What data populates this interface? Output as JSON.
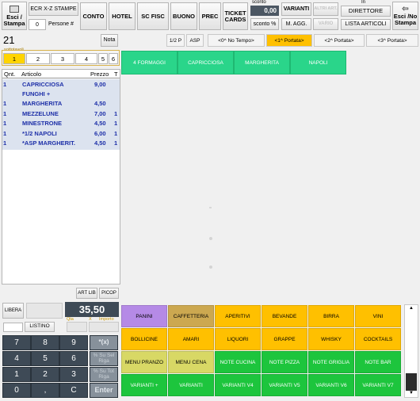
{
  "toolbar": {
    "esci_stampa": "Esci / Stampa",
    "ecr_xz": "ECR X-Z STAMPE",
    "persone_count": "0",
    "persone_label": "Persone #",
    "conto": "CONTO",
    "hotel": "HOTEL",
    "sc_fisc": "SC FISC",
    "buono": "BUONO",
    "prec": "PREC",
    "ticket_cards": "TICKET CARDS",
    "sconto_label": "sconto",
    "sconto_value": "0,00",
    "sconto_pct": "sconto %",
    "varianti": "VARIANTI",
    "m_agg": "M. AGG.",
    "disabled_top": "ALTRI ART.",
    "disabled_bottom": "VARIO",
    "in_label": "In",
    "direttore": "DIRETTORE",
    "lista_articoli": "LISTA ARTICOLI",
    "esci_no_stampa": "Esci /No Stampa"
  },
  "order": {
    "table_number": "21",
    "nota": "Nota",
    "sottotavoli_label": "sottotavoli",
    "subtables": [
      "1",
      "2",
      "3",
      "4",
      "5",
      "6"
    ],
    "columns": {
      "qnt": "Qnt.",
      "articolo": "Articolo",
      "prezzo": "Prezzo",
      "t": "T"
    },
    "rows": [
      {
        "qnt": "1",
        "articolo": "CAPRICCIOSA",
        "prezzo": "9,00",
        "t": ""
      },
      {
        "qnt": "",
        "articolo": "FUNGHI +",
        "prezzo": "",
        "t": ""
      },
      {
        "qnt": "1",
        "articolo": "MARGHERITA",
        "prezzo": "4,50",
        "t": ""
      },
      {
        "qnt": "1",
        "articolo": "MEZZELUNE",
        "prezzo": "7,00",
        "t": "1"
      },
      {
        "qnt": "1",
        "articolo": "MINESTRONE",
        "prezzo": "4,50",
        "t": "1"
      },
      {
        "qnt": "1",
        "articolo": "*1/2 NAPOLI",
        "prezzo": "6,00",
        "t": "1"
      },
      {
        "qnt": "1",
        "articolo": "*ASP MARGHERIT.",
        "prezzo": "4,50",
        "t": "1"
      }
    ],
    "art_lib": "ART LIB",
    "picop": "PICOP"
  },
  "bottom_left": {
    "libera": "LIBERA",
    "libera_disabled": "",
    "total": "35,50",
    "qta_label": "Qta",
    "x_label": "X",
    "importo_label": "Importo",
    "listino": "LISTINO"
  },
  "keypad": {
    "k7": "7",
    "k8": "8",
    "k9": "9",
    "star": "*(x)",
    "k4": "4",
    "k5": "5",
    "k6": "6",
    "g1": "% Su Sel Riga",
    "k1": "1",
    "k2": "2",
    "k3": "3",
    "g2": "% Su Tot Riga",
    "k0": "0",
    "comma": ",",
    "c": "C",
    "enter": "Enter"
  },
  "portate": {
    "half": "1/2 P",
    "asp": "ASP",
    "tabs": [
      "<0^ No Tempo>",
      "<1^ Portata>",
      "<2^ Portata>",
      "<3^ Portata>"
    ],
    "selected": "<1^ Portata>"
  },
  "articles": [
    "4 FORMAGGI",
    "CAPRICCIOSA",
    "MARGHERITA",
    "NAPOLI"
  ],
  "categories": [
    {
      "label": "PANINI",
      "color": "#b58ae6"
    },
    {
      "label": "CAFFETTERIA",
      "color": "#cca850"
    },
    {
      "label": "APERITIVI",
      "color": "#ffc000"
    },
    {
      "label": "BEVANDE",
      "color": "#ffc000"
    },
    {
      "label": "BIRRA",
      "color": "#ffc000"
    },
    {
      "label": "VINI",
      "color": "#ffc000"
    },
    {
      "label": "BOLLICINE",
      "color": "#ffc000"
    },
    {
      "label": "AMARI",
      "color": "#ffc000"
    },
    {
      "label": "LIQUORI",
      "color": "#ffc000"
    },
    {
      "label": "GRAPPE",
      "color": "#ffc000"
    },
    {
      "label": "WHISKY",
      "color": "#ffc000"
    },
    {
      "label": "COCKTAILS",
      "color": "#ffc000"
    },
    {
      "label": "MENU PRANZO",
      "color": "#d8d865"
    },
    {
      "label": "MENU CENA",
      "color": "#d8d865"
    },
    {
      "label": "NOTE CUCINA",
      "color": "#1dc53d"
    },
    {
      "label": "NOTE PIZZA",
      "color": "#1dc53d"
    },
    {
      "label": "NOTE GRIGLIA",
      "color": "#1dc53d"
    },
    {
      "label": "NOTE BAR",
      "color": "#1dc53d"
    },
    {
      "label": "VARIANTI +",
      "color": "#1dc53d"
    },
    {
      "label": "VARIANTI",
      "color": "#1dc53d"
    },
    {
      "label": "VARIANTI V4",
      "color": "#1dc53d"
    },
    {
      "label": "VARIANTI V5",
      "color": "#1dc53d"
    },
    {
      "label": "VARIANTI V6",
      "color": "#1dc53d"
    },
    {
      "label": "VARIANTI V7",
      "color": "#1dc53d"
    }
  ]
}
